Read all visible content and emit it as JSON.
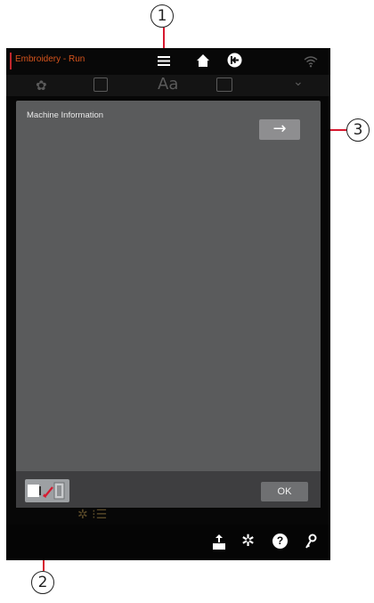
{
  "header": {
    "title": "Embroidery - Run",
    "accent_color": "#c1272d",
    "title_color": "#d6541c",
    "icons": [
      "menu-icon",
      "home-icon",
      "return-icon",
      "wifi-icon"
    ]
  },
  "tabs": {
    "icons": [
      "flower-icon",
      "design-icon",
      "text-icon",
      "edit-icon",
      "chevron-down-icon"
    ],
    "text_tab_label": "Aa"
  },
  "dialog": {
    "title": "Machine Information",
    "next_symbol": "→",
    "ok_label": "OK"
  },
  "bottom_toolbar": {
    "icons": [
      "export-icon",
      "settings-icon",
      "help-icon",
      "key-icon"
    ],
    "help_symbol": "?"
  },
  "callouts": [
    {
      "number": "1",
      "target": "menu-icon"
    },
    {
      "number": "2",
      "target": "footer-icon-button"
    },
    {
      "number": "3",
      "target": "next-arrow-button"
    }
  ]
}
